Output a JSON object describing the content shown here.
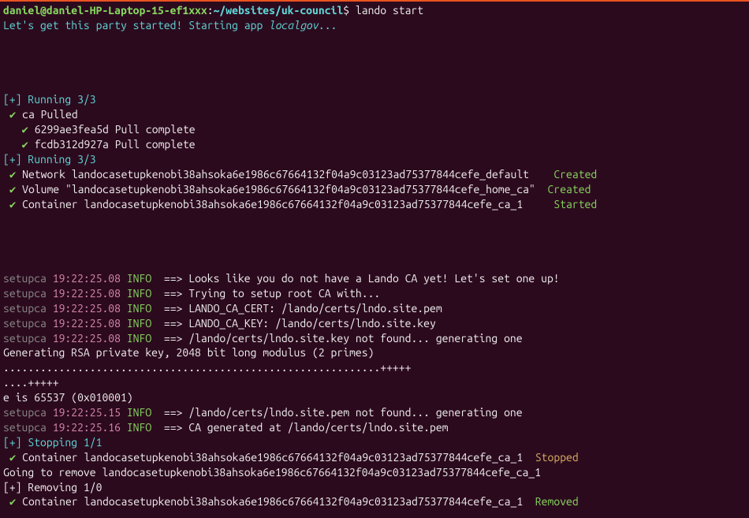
{
  "prompt": {
    "user_host": "daniel@daniel-HP-Laptop-15-ef1xxx",
    "colon": ":",
    "path": "~/websites/uk-council",
    "dollar": "$ ",
    "command": "lando start"
  },
  "startup": {
    "prefix": "Let's get this party started! Starting app ",
    "appname": "localgov",
    "suffix": "..."
  },
  "run1": {
    "label": "[+] Running 3/3",
    "l1_check": " ✔ ",
    "l1_text": "ca Pulled",
    "l2_check": "   ✔ ",
    "l2_text": "6299ae3fea5d Pull complete",
    "l3_check": "   ✔ ",
    "l3_text": "fcdb312d927a Pull complete"
  },
  "run2": {
    "label": "[+] Running 3/3",
    "net_check": " ✔ ",
    "net_label": "Network ",
    "net_name": "landocasetupkenobi38ahsoka6e1986c67664132f04a9c03123ad75377844cefe_default    ",
    "net_status": "Created",
    "vol_check": " ✔ ",
    "vol_label": "Volume ",
    "vol_name": "\"landocasetupkenobi38ahsoka6e1986c67664132f04a9c03123ad75377844cefe_home_ca\"  ",
    "vol_status": "Created",
    "con_check": " ✔ ",
    "con_label": "Container ",
    "con_name": "landocasetupkenobi38ahsoka6e1986c67664132f04a9c03123ad75377844cefe_ca_1     ",
    "con_status": "Started"
  },
  "log": {
    "svc": "setupca ",
    "t1": "19:22:25.08 ",
    "t2": "19:22:25.15 ",
    "t3": "19:22:25.16 ",
    "lvl": "INFO ",
    "m1": " ==> Looks like you do not have a Lando CA yet! Let's set one up!",
    "m2": " ==> Trying to setup root CA with...",
    "m3": " ==> LANDO_CA_CERT: /lando/certs/lndo.site.pem",
    "m4": " ==> LANDO_CA_KEY: /lando/certs/lndo.site.key",
    "m5": " ==> /lando/certs/lndo.site.key not found... generating one",
    "m6": " ==> /lando/certs/lndo.site.pem not found... generating one",
    "m7": " ==> CA generated at /lando/certs/lndo.site.pem"
  },
  "rsa": {
    "l1": "Generating RSA private key, 2048 bit long modulus (2 primes)",
    "l2": ".............................................................+++++",
    "l3": "....+++++",
    "l4": "e is 65537 (0x010001)"
  },
  "stop": {
    "label": "[+] Stopping 1/1",
    "check": " ✔ ",
    "con_label": "Container ",
    "con_name": "landocasetupkenobi38ahsoka6e1986c67664132f04a9c03123ad75377844cefe_ca_1  ",
    "status": "Stopped"
  },
  "remove": {
    "going": "Going to remove landocasetupkenobi38ahsoka6e1986c67664132f04a9c03123ad75377844cefe_ca_1",
    "label": "[+] Removing 1/0",
    "check": " ✔ ",
    "con_label": "Container ",
    "con_name": "landocasetupkenobi38ahsoka6e1986c67664132f04a9c03123ad75377844cefe_ca_1  ",
    "status": "Removed"
  }
}
